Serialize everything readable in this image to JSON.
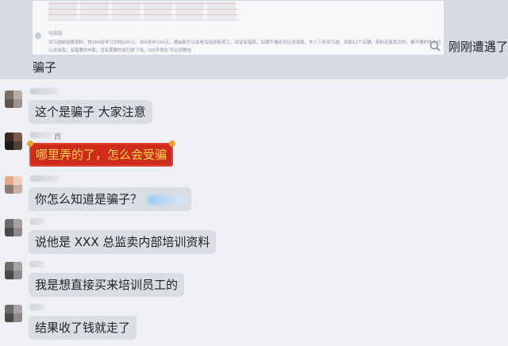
{
  "top_message": {
    "shared_image": {
      "caption": "电脑版",
      "description": "亚马逊超级美资料，快200份学习文档100元；300多份150元，通会新手以及老鸟培训新员工，保证有借助，后期不懂还可以咨询我，本人三年亚马逊，目前11个店铺，资料还是其次的，看不懂的地方可以咨询我；有需要的M我，没有需要的说打扰了哈，QQ不常在 可以加微信"
    },
    "tail_text": "刚刚遭遇了",
    "line2": "骗子"
  },
  "messages": [
    {
      "text": "这个是骗子 大家注意",
      "style": "normal"
    },
    {
      "text": "哪里弄的了，怎么会受骗",
      "style": "red",
      "name_suffix": "西"
    },
    {
      "text": "你怎么知道是骗子？",
      "style": "normal",
      "has_emoji": true
    },
    {
      "text": "说他是 XXX 总监卖内部培训资料",
      "style": "normal"
    },
    {
      "text": "我是想直接买来培训员工的",
      "style": "normal"
    },
    {
      "text": "结果收了钱就走了",
      "style": "normal"
    }
  ],
  "colors": {
    "background": "#eef0f3",
    "bubble": "#d9dde4",
    "red_bubble": "#cf2b1c",
    "red_bubble_text": "#ffd84a"
  },
  "icons": [
    "zoom-icon"
  ]
}
